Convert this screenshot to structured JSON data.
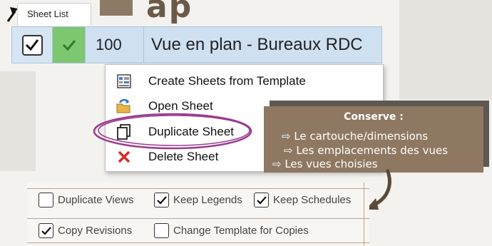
{
  "header": {
    "title_text": "ap"
  },
  "tab": {
    "label": "Sheet List"
  },
  "sheet_row": {
    "checked": true,
    "number": "100",
    "name": "Vue en plan - Bureaux RDC"
  },
  "context_menu": {
    "items": [
      {
        "label": "Create Sheets from Template",
        "icon": "template-grid-icon"
      },
      {
        "label": "Open Sheet",
        "icon": "open-sheet-icon"
      },
      {
        "label": "Duplicate Sheet",
        "icon": "duplicate-icon"
      },
      {
        "label": "Delete Sheet",
        "icon": "delete-x-icon"
      }
    ]
  },
  "callout": {
    "title": "Conserve :",
    "lines": [
      "⇨ Le cartouche/dimensions",
      "⇨ Les emplacements des vues",
      "⇨   Les vues choisies"
    ]
  },
  "options": [
    {
      "label": "Duplicate Views",
      "checked": false
    },
    {
      "label": "Keep Legends",
      "checked": true
    },
    {
      "label": "Keep Schedules",
      "checked": true
    },
    {
      "label": "Copy Revisions",
      "checked": true
    },
    {
      "label": "Change Template for Copies",
      "checked": false
    }
  ],
  "colors": {
    "accent_brown": "#8e7862",
    "highlight_purple": "#9b3d8f",
    "row_blue": "#cfe0f1",
    "status_green": "#7cc770",
    "delete_red": "#d62b2b"
  }
}
